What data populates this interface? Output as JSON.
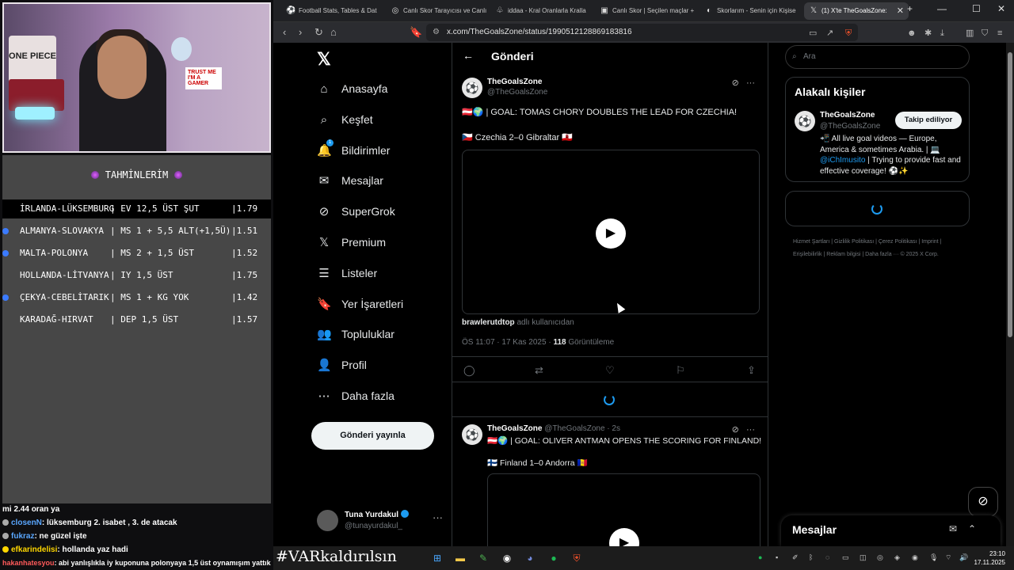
{
  "stream": {
    "webcam": {
      "poster_text": "ONE PIECE",
      "screen_text": "TRUST ME I'M A GAMER"
    },
    "predictions": {
      "title": "TAHMİNLERİM",
      "rows": [
        {
          "team": "İRLANDA-LÜKSEMBURG",
          "bet": "| EV 12,5 ÜST ŞUT",
          "odd": "|1.79",
          "bullet": false
        },
        {
          "team": "ALMANYA-SLOVAKYA",
          "bet": "| MS 1 + 5,5 ALT(+1,5Ü)",
          "odd": "|1.51",
          "bullet": true
        },
        {
          "team": "MALTA-POLONYA",
          "bet": "| MS 2 + 1,5 ÜST",
          "odd": "|1.52",
          "bullet": true
        },
        {
          "team": "HOLLANDA-LİTVANYA",
          "bet": "| IY 1,5 ÜST",
          "odd": "|1.75",
          "bullet": false
        },
        {
          "team": "ÇEKYA-CEBELİTARIK",
          "bet": "| MS 1 + KG YOK",
          "odd": "|1.42",
          "bullet": true
        },
        {
          "team": "KARADAĞ-HIRVAT",
          "bet": "| DEP 1,5 ÜST",
          "odd": "|1.57",
          "bullet": false
        }
      ]
    },
    "chat": [
      {
        "user": "",
        "msg": "mi 2.44 oran ya"
      },
      {
        "user": "closenN",
        "msg": ": lüksemburg 2. isabet , 3. de atacak"
      },
      {
        "user": "fukraz",
        "msg": ": ne güzel işte"
      },
      {
        "user": "efkarindelisi",
        "msg": ": hollanda yaz hadi"
      },
      {
        "user": "hakanhatesyou",
        "msg": ": abi yanlışlıkla iy kuponuna polonyaya 1,5 üst oynamışım yattık"
      }
    ],
    "hashtag": "#VARkaldırılsın"
  },
  "browser": {
    "tabs": [
      {
        "icon": "⚽",
        "label": "Football Stats, Tables & Dat",
        "active": false
      },
      {
        "icon": "◎",
        "label": "Canlı Skor Tarayıcısı ve Canlı",
        "active": false
      },
      {
        "icon": "♧",
        "label": "iddaa - Kral Oranlarla Kralla",
        "active": false
      },
      {
        "icon": "▣",
        "label": "Canlı Skor | Seçilen maçlar +",
        "active": false
      },
      {
        "icon": "◐",
        "label": "Skorlarım - Senin için Kişise",
        "active": false
      },
      {
        "icon": "𝕏",
        "label": "(1) X'te TheGoalsZone:",
        "active": true
      }
    ],
    "url": "x.com/TheGoalsZone/status/1990512128869183816"
  },
  "x": {
    "nav": [
      {
        "icon": "⌂",
        "label": "Anasayfa"
      },
      {
        "icon": "⌕",
        "label": "Keşfet"
      },
      {
        "icon": "🔔",
        "label": "Bildirimler",
        "badge": "1"
      },
      {
        "icon": "✉",
        "label": "Mesajlar"
      },
      {
        "icon": "⊘",
        "label": "SuperGrok"
      },
      {
        "icon": "𝕏",
        "label": "Premium"
      },
      {
        "icon": "☰",
        "label": "Listeler"
      },
      {
        "icon": "🔖",
        "label": "Yer İşaretleri"
      },
      {
        "icon": "👥",
        "label": "Topluluklar"
      },
      {
        "icon": "👤",
        "label": "Profil"
      },
      {
        "icon": "⋯",
        "label": "Daha fazla"
      }
    ],
    "post_button": "Gönderi yayınla",
    "account": {
      "name": "Tuna Yurdakul",
      "handle": "@tunayurdakul_"
    },
    "header_title": "Gönderi",
    "tweet": {
      "name": "TheGoalsZone",
      "handle": "@TheGoalsZone",
      "text": "🇦🇹🌍 | GOAL: TOMAS CHORY DOUBLES THE LEAD FOR CZECHIA!",
      "score": "🇨🇿 Czechia 2–0 Gibraltar 🇬🇮",
      "attribution_user": "brawlerutdtop",
      "attribution_suffix": "adlı kullanıcıdan",
      "time": "ÖS 11:07 · 17 Kas 2025 · ",
      "views": "118",
      "views_label": "Görüntüleme"
    },
    "reply": {
      "name": "TheGoalsZone",
      "handle": "@TheGoalsZone · 2s",
      "text": "🇦🇹🌍 | GOAL: OLIVER ANTMAN OPENS THE SCORING FOR FINLAND!",
      "score": "🇫🇮 Finland 1–0 Andorra 🇦🇩"
    },
    "search_placeholder": "Ara",
    "related": {
      "title": "Alakalı kişiler",
      "name": "TheGoalsZone",
      "handle": "@TheGoalsZone",
      "follow_label": "Takip ediliyor",
      "bio_pre": "📲 All live goal videos — Europe, America & sometimes Arabia. | 💻 ",
      "bio_link": "@iChImusito",
      "bio_post": " | Trying to provide fast and effective coverage! ⚽✨"
    },
    "footer": "Hizmet Şartları  |  Gizlilik Politikası  |  Çerez Politikası  |  Imprint  |  Erişilebilirlik  |  Reklam bilgisi  |  Daha fazla ···  © 2025 X Corp.",
    "messages_label": "Mesajlar"
  },
  "taskbar": {
    "time": "23:10",
    "date": "17.11.2025"
  }
}
